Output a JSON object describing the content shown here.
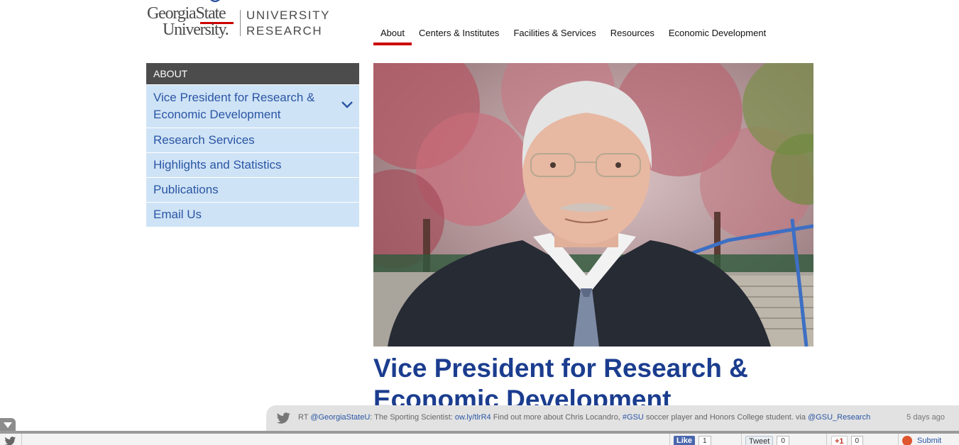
{
  "logo": {
    "line1": "GeorgiaState",
    "line2": "University.",
    "unit1": "UNIVERSITY",
    "unit2": "RESEARCH"
  },
  "topnav": {
    "items": [
      "About",
      "Centers & Institutes",
      "Facilities & Services",
      "Resources",
      "Economic Development"
    ],
    "active": "About"
  },
  "sidebar": {
    "heading": "ABOUT",
    "items": [
      {
        "label": "Vice President for Research & Economic Development"
      },
      {
        "label": "Research Services"
      },
      {
        "label": "Highlights and Statistics"
      },
      {
        "label": "Publications"
      },
      {
        "label": "Email Us"
      }
    ]
  },
  "page": {
    "title": "Vice President for Research & Economic Development"
  },
  "ticker": {
    "prefix": "RT ",
    "handle": "@GeorgiaStateU",
    "text1": ": The Sporting Scientist: ",
    "link": "ow.ly/tlrR4",
    "text2": " Find out more about Chris Locandro, ",
    "hashtag": "#GSU",
    "text3": " soccer player and Honors College student. via ",
    "via": "@GSU_Research",
    "time": "5 days ago"
  },
  "share": {
    "fb_label": "Like",
    "fb_count": "1",
    "tw_label": "Tweet",
    "tw_count": "0",
    "gp_label": "+1",
    "gp_count": "0",
    "su_label": "Submit"
  },
  "colors": {
    "accent_red": "#cc0000",
    "title_blue": "#1b3d8f",
    "sidebar_bg": "#cfe3f6",
    "sidebar_head": "#4c4c4c"
  }
}
